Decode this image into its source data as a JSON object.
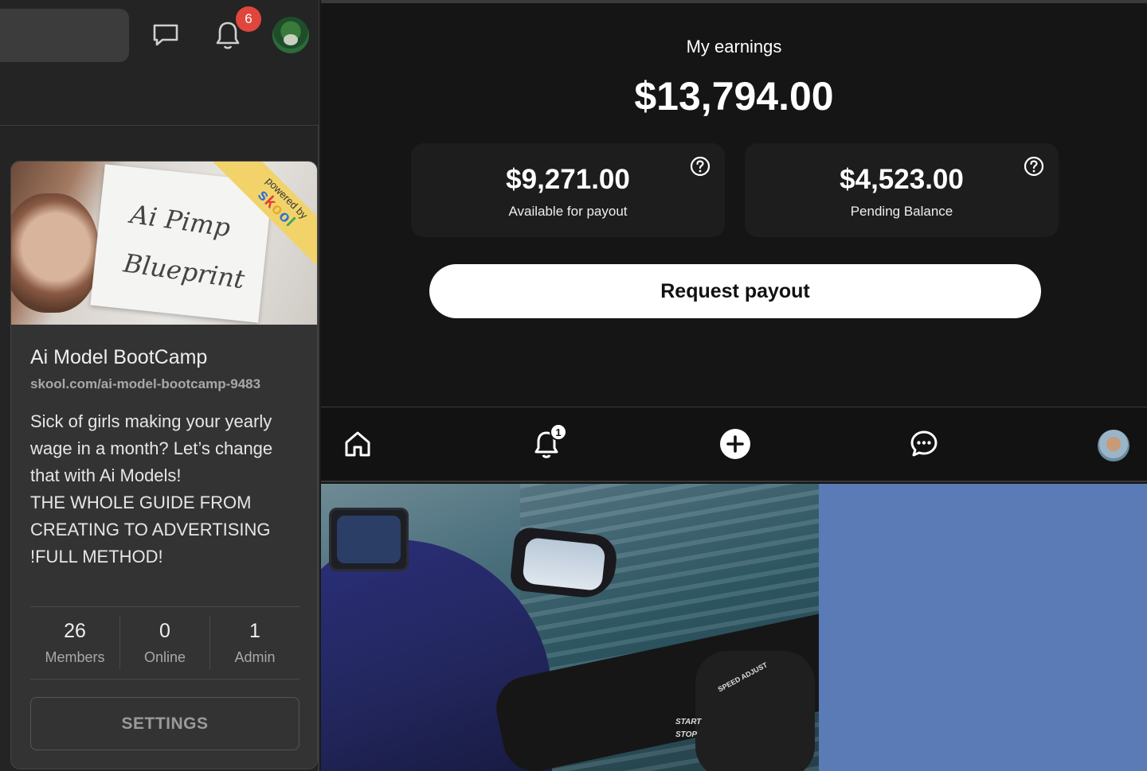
{
  "topbar": {
    "notification_count": "6"
  },
  "group": {
    "cover_ribbon_text": "powered by",
    "cover_ribbon_brand": "skool",
    "cover_sign_text": "Ai Pimp Blueprint",
    "name": "Ai Model BootCamp",
    "url": "skool.com/ai-model-bootcamp-9483",
    "description_lines": [
      "Sick of girls making your yearly",
      "wage in a month? Let’s change",
      "that with Ai Models!",
      "THE WHOLE GUIDE FROM",
      "CREATING TO ADVERTISING",
      "!FULL METHOD!"
    ],
    "stats": [
      {
        "value": "26",
        "label": "Members"
      },
      {
        "value": "0",
        "label": "Online"
      },
      {
        "value": "1",
        "label": "Admin"
      }
    ],
    "settings_label": "SETTINGS"
  },
  "earnings": {
    "title": "My earnings",
    "total": "$13,794.00",
    "available_amount": "$9,271.00",
    "available_label": "Available for payout",
    "pending_amount": "$4,523.00",
    "pending_label": "Pending Balance",
    "payout_button": "Request payout"
  },
  "bottom_nav": {
    "notification_count": "1",
    "items": [
      "home-icon",
      "bell-icon",
      "plus-icon",
      "chat-icon",
      "profile-avatar"
    ]
  },
  "photo": {
    "label_lines": [
      "START",
      "STOP"
    ],
    "speed_label": "SPEED ADJUST"
  },
  "colors": {
    "badge": "#e0463e",
    "ribbon": "#f1d36a",
    "blue_panel": "#5a7bb5",
    "background": "#151515"
  }
}
